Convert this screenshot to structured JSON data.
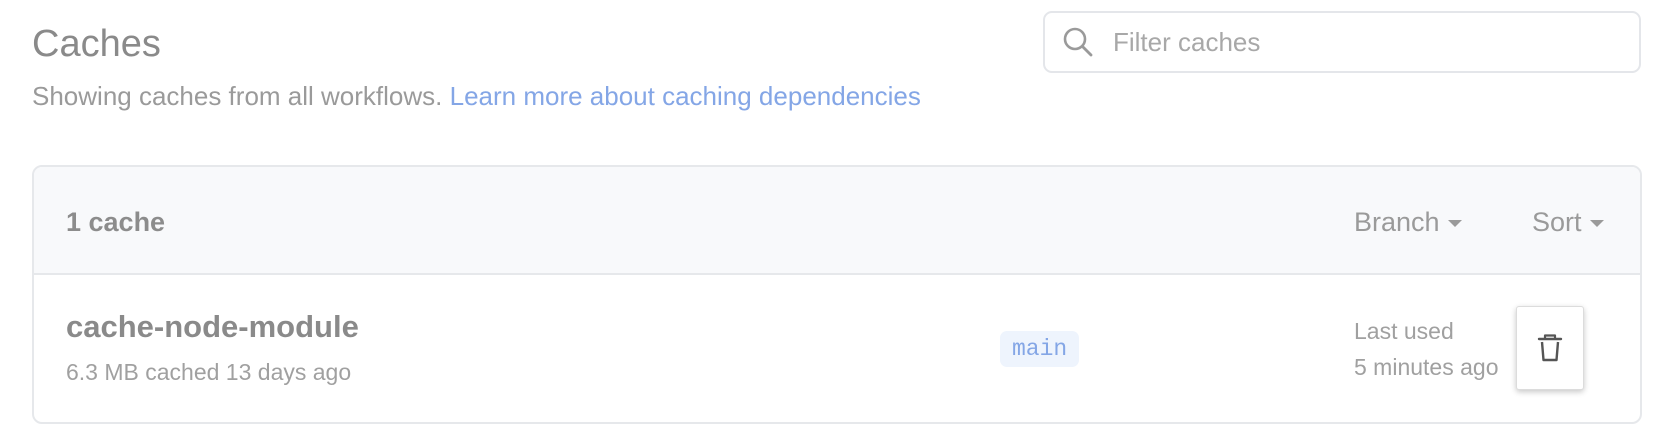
{
  "header": {
    "title": "Caches",
    "subtitle": "Showing caches from all workflows.",
    "learn_more_link": "Learn more about caching dependencies"
  },
  "search": {
    "placeholder": "Filter caches",
    "value": "",
    "icon": "search-icon"
  },
  "list": {
    "count_label": "1 cache",
    "branch_menu_label": "Branch",
    "sort_menu_label": "Sort",
    "items": [
      {
        "name": "cache-node-module",
        "meta": "6.3 MB cached 13 days ago",
        "branch": "main",
        "last_used_label": "Last used",
        "last_used_value": "5 minutes ago",
        "delete_icon": "trash-icon"
      }
    ]
  },
  "colors": {
    "link": "#84a6e6",
    "badge_bg": "#eef4fd",
    "header_bg": "#f8f9fb",
    "border": "#e6e8eb"
  }
}
